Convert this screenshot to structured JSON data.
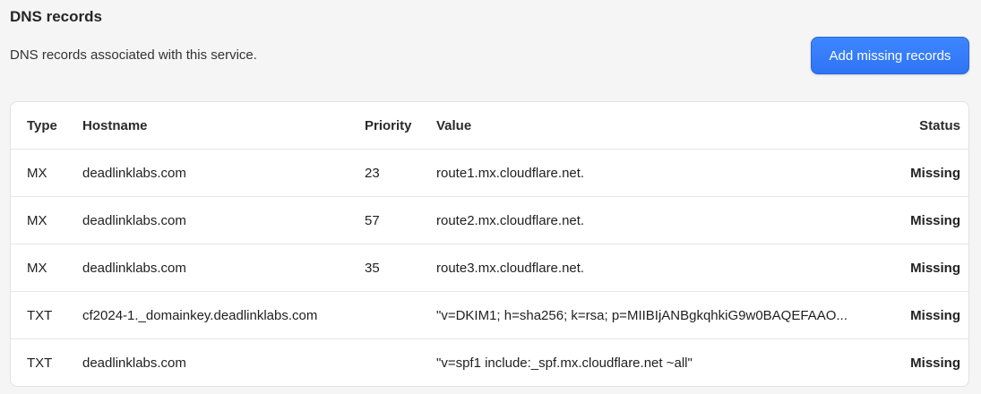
{
  "header": {
    "title": "DNS records",
    "description": "DNS records associated with this service.",
    "add_button_label": "Add missing records"
  },
  "table": {
    "columns": {
      "type": "Type",
      "hostname": "Hostname",
      "priority": "Priority",
      "value": "Value",
      "status": "Status"
    },
    "rows": [
      {
        "type": "MX",
        "hostname": "deadlinklabs.com",
        "priority": "23",
        "value": "route1.mx.cloudflare.net.",
        "status": "Missing"
      },
      {
        "type": "MX",
        "hostname": "deadlinklabs.com",
        "priority": "57",
        "value": "route2.mx.cloudflare.net.",
        "status": "Missing"
      },
      {
        "type": "MX",
        "hostname": "deadlinklabs.com",
        "priority": "35",
        "value": "route3.mx.cloudflare.net.",
        "status": "Missing"
      },
      {
        "type": "TXT",
        "hostname": "cf2024-1._domainkey.deadlinklabs.com",
        "priority": "",
        "value": "\"v=DKIM1; h=sha256; k=rsa; p=MIIBIjANBgkqhkiG9w0BAQEFAAO...",
        "status": "Missing"
      },
      {
        "type": "TXT",
        "hostname": "deadlinklabs.com",
        "priority": "",
        "value": "\"v=spf1 include:_spf.mx.cloudflare.net ~all\"",
        "status": "Missing"
      }
    ]
  },
  "colors": {
    "accent": "#3179f7",
    "background": "#f5f5f5"
  }
}
